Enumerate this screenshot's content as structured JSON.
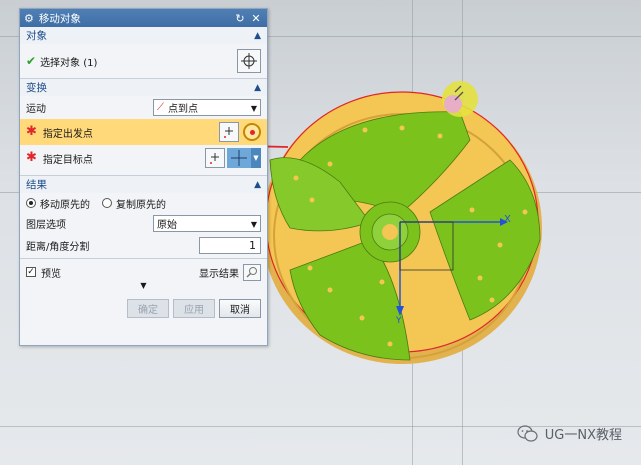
{
  "dialog": {
    "title": "移动对象",
    "sections": {
      "object": {
        "header": "对象",
        "select_label": "选择对象 (1)"
      },
      "transform": {
        "header": "变换",
        "motion_label": "运动",
        "motion_value": "点到点",
        "from_point_label": "指定出发点",
        "to_point_label": "指定目标点"
      },
      "result": {
        "header": "结果",
        "move_original": "移动原先的",
        "copy_original": "复制原先的",
        "move_selected": true,
        "layer_label": "图层选项",
        "layer_value": "原始",
        "distance_label": "距离/角度分割",
        "distance_value": "1"
      }
    },
    "preview_label": "预览",
    "preview_checked": true,
    "show_result_label": "显示结果",
    "buttons": {
      "ok": "确定",
      "apply": "应用",
      "cancel": "取消"
    }
  },
  "viewport": {
    "axis_x_label": "X",
    "axis_y_label": "Y",
    "colors": {
      "blade": "#7cc21d",
      "hub": "#f7c94a",
      "rim": "#d6a63f",
      "red_marker": "#e0262a",
      "triad": "#2453d8"
    }
  },
  "watermark": {
    "text": "UG一NX教程",
    "icon": "wechat-icon"
  }
}
